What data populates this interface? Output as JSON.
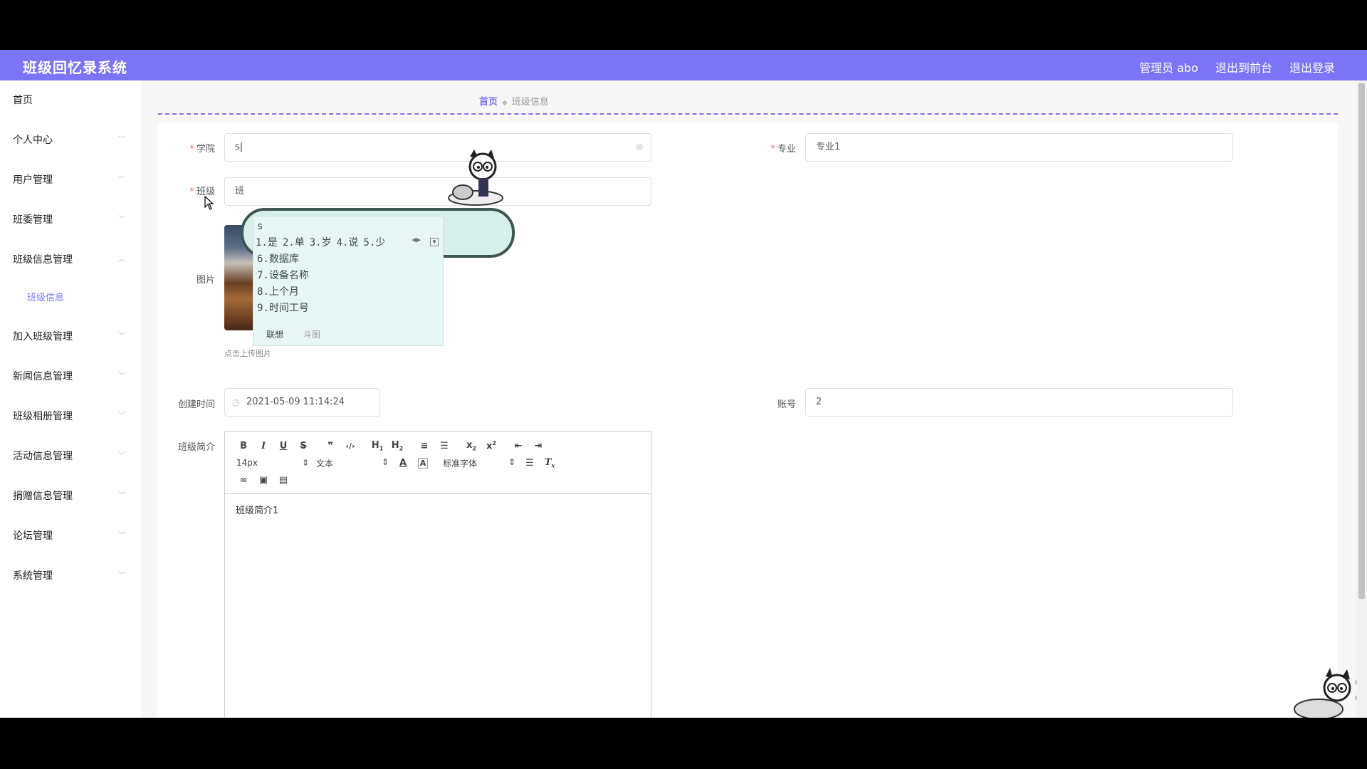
{
  "header": {
    "title": "班级回忆录系统",
    "user": "管理员 abo",
    "front": "退出到前台",
    "logout": "退出登录"
  },
  "sidebar": {
    "items": [
      {
        "label": "首页"
      },
      {
        "label": "个人中心"
      },
      {
        "label": "用户管理"
      },
      {
        "label": "班委管理"
      },
      {
        "label": "班级信息管理"
      },
      {
        "label": "加入班级管理"
      },
      {
        "label": "新闻信息管理"
      },
      {
        "label": "班级相册管理"
      },
      {
        "label": "活动信息管理"
      },
      {
        "label": "捐赠信息管理"
      },
      {
        "label": "论坛管理"
      },
      {
        "label": "系统管理"
      }
    ],
    "subitem": "班级信息"
  },
  "breadcrumb": {
    "home": "首页",
    "current": "班级信息"
  },
  "form": {
    "college_label": "学院",
    "college_value": "s",
    "major_label": "专业",
    "major_value": "专业1",
    "class_label": "班",
    "class_value": "班",
    "class_label_full": "班级",
    "image_label": "图片",
    "upload_hint": "点击上传图片",
    "created_label": "创建时间",
    "created_value": "2021-05-09 11:14:24",
    "account_label": "账号",
    "account_value": "2",
    "intro_label": "班级简介"
  },
  "editor": {
    "font_size": "14px",
    "header_select": "文本",
    "font_family": "标准字体",
    "content": "班级简介1",
    "toolbar_icons": [
      "bold-icon",
      "italic-icon",
      "underline-icon",
      "strike-icon",
      "blockquote-icon",
      "code-icon",
      "h1-icon",
      "h2-icon",
      "ordered-list-icon",
      "bullet-list-icon",
      "subscript-icon",
      "superscript-icon",
      "outdent-icon",
      "indent-icon",
      "font-color-icon",
      "background-color-icon",
      "align-icon",
      "clear-format-icon",
      "link-icon",
      "image-icon",
      "video-icon"
    ]
  },
  "ime": {
    "pinyin": "s",
    "candidates": [
      "1.是",
      "2.单",
      "3.岁",
      "4.说",
      "5.少"
    ],
    "list": [
      "6.数据库",
      "7.设备名称",
      "8.上个月",
      "9.时间工号"
    ],
    "tab_active": "联想",
    "tab_inactive": "斗图"
  },
  "colors": {
    "accent": "#7b74f7",
    "required": "#f56c6c"
  }
}
